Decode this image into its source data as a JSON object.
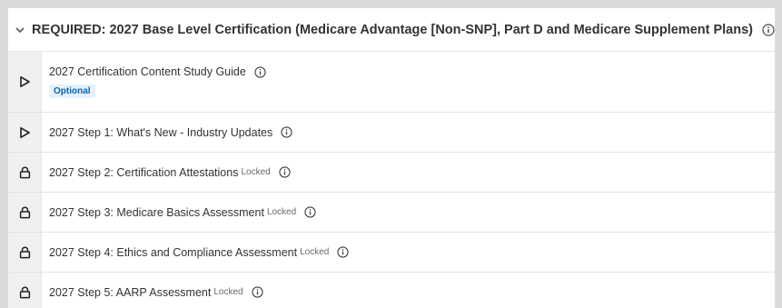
{
  "section": {
    "title": "REQUIRED: 2027 Base Level Certification (Medicare Advantage [Non-SNP], Part D and Medicare Supplement Plans)",
    "expand_icon": "chevron-down-icon",
    "info_icon": "info-icon"
  },
  "items": [
    {
      "title": "2027 Certification Content Study Guide",
      "status_icon": "play-icon",
      "badge": "Optional",
      "locked_label": ""
    },
    {
      "title": "2027 Step 1: What's New - Industry Updates",
      "status_icon": "play-icon",
      "badge": "",
      "locked_label": ""
    },
    {
      "title": "2027 Step 2: Certification Attestations",
      "status_icon": "lock-icon",
      "badge": "",
      "locked_label": "Locked"
    },
    {
      "title": "2027 Step 3: Medicare Basics Assessment",
      "status_icon": "lock-icon",
      "badge": "",
      "locked_label": "Locked"
    },
    {
      "title": "2027 Step 4: Ethics and Compliance Assessment",
      "status_icon": "lock-icon",
      "badge": "",
      "locked_label": "Locked"
    },
    {
      "title": "2027 Step 5: AARP Assessment",
      "status_icon": "lock-icon",
      "badge": "",
      "locked_label": "Locked"
    }
  ],
  "colors": {
    "badge_bg": "#e6f1fb",
    "badge_text": "#0a63b0",
    "icon_cell_bg": "#f0f0f0"
  }
}
